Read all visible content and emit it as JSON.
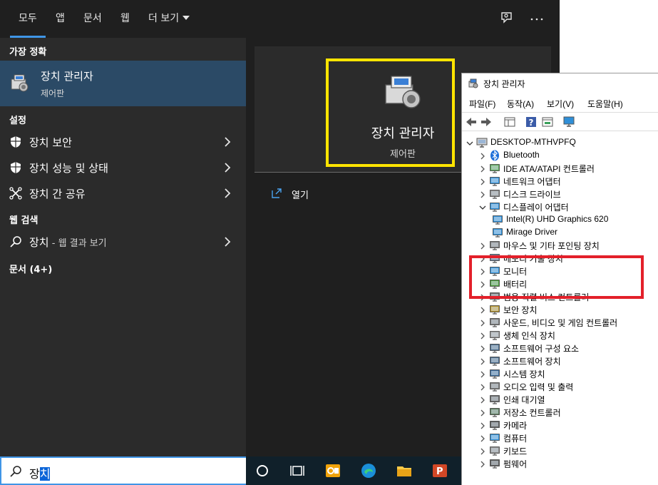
{
  "start": {
    "tabs": [
      "모두",
      "앱",
      "문서",
      "웹",
      "더 보기"
    ],
    "active_tab": "모두",
    "sections": {
      "best_match": "가장 정확",
      "settings": "설정",
      "web_search": "웹 검색",
      "documents": "문서 (4+)"
    },
    "best_match": {
      "title": "장치 관리자",
      "subtitle": "제어판"
    },
    "settings_items": [
      "장치 보안",
      "장치 성능 및 상태",
      "장치 간 공유"
    ],
    "web_item": {
      "label": "장치",
      "sub": " - 웹 결과 보기"
    },
    "search": {
      "typed": "장",
      "selected": "치"
    },
    "preview": {
      "title": "장치 관리자",
      "subtitle": "제어판",
      "open_label": "열기"
    },
    "accent": "#3f95e6"
  },
  "device_manager": {
    "title": "장치 관리자",
    "menu": [
      "파일(F)",
      "동작(A)",
      "보기(V)",
      "도움말(H)"
    ],
    "root": "DESKTOP-MTHVPFQ",
    "nodes": [
      {
        "label": "Bluetooth",
        "icon": "bluetooth-icon"
      },
      {
        "label": "IDE ATA/ATAPI 컨트롤러",
        "icon": "ide-icon"
      },
      {
        "label": "네트워크 어댑터",
        "icon": "network-icon"
      },
      {
        "label": "디스크 드라이브",
        "icon": "disk-icon"
      },
      {
        "label": "디스플레이 어댑터",
        "icon": "display-icon",
        "expanded": true
      },
      {
        "label": "Intel(R) UHD Graphics 620",
        "icon": "display-icon",
        "child": true
      },
      {
        "label": "Mirage Driver",
        "icon": "display-icon",
        "child": true
      },
      {
        "label": "마우스 및 기타 포인팅 장치",
        "icon": "mouse-icon"
      },
      {
        "label": "메모리 기술 장치",
        "icon": "memory-icon"
      },
      {
        "label": "모니터",
        "icon": "monitor-icon"
      },
      {
        "label": "배터리",
        "icon": "battery-icon"
      },
      {
        "label": "범용 직렬 버스 컨트롤러",
        "icon": "usb-icon"
      },
      {
        "label": "보안 장치",
        "icon": "security-icon"
      },
      {
        "label": "사운드, 비디오 및 게임 컨트롤러",
        "icon": "sound-icon"
      },
      {
        "label": "생체 인식 장치",
        "icon": "biometric-icon"
      },
      {
        "label": "소프트웨어 구성 요소",
        "icon": "software-icon"
      },
      {
        "label": "소프트웨어 장치",
        "icon": "software-icon"
      },
      {
        "label": "시스템 장치",
        "icon": "system-icon"
      },
      {
        "label": "오디오 입력 및 출력",
        "icon": "audio-icon"
      },
      {
        "label": "인쇄 대기열",
        "icon": "printer-icon"
      },
      {
        "label": "저장소 컨트롤러",
        "icon": "storage-icon"
      },
      {
        "label": "카메라",
        "icon": "camera-icon"
      },
      {
        "label": "컴퓨터",
        "icon": "computer-icon"
      },
      {
        "label": "키보드",
        "icon": "keyboard-icon"
      },
      {
        "label": "펌웨어",
        "icon": "firmware-icon"
      }
    ],
    "highlight_color": "#e3202a"
  },
  "highlight_yellow": "#ffe400"
}
